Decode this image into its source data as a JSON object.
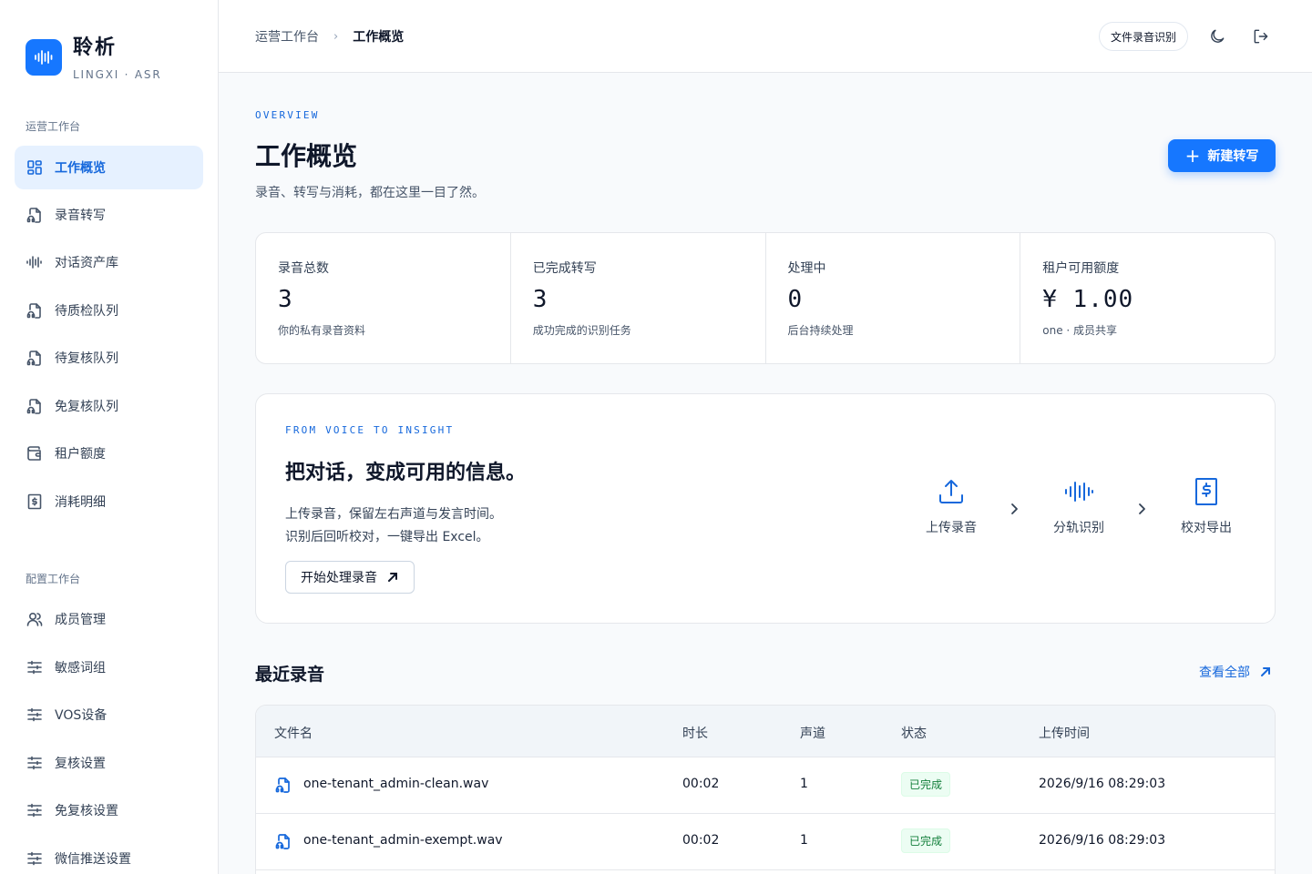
{
  "brand": {
    "name": "聆析",
    "sub": "LINGXI · ASR"
  },
  "sidebar": {
    "section1": "运营工作台",
    "section2": "配置工作台",
    "items": [
      {
        "label": "工作概览",
        "icon": "dashboard-icon"
      },
      {
        "label": "录音转写",
        "icon": "audio-file-icon"
      },
      {
        "label": "对话资产库",
        "icon": "waveform-icon"
      },
      {
        "label": "待质检队列",
        "icon": "audio-file-icon"
      },
      {
        "label": "待复核队列",
        "icon": "audio-file-icon"
      },
      {
        "label": "免复核队列",
        "icon": "audio-file-icon"
      },
      {
        "label": "租户额度",
        "icon": "wallet-icon"
      },
      {
        "label": "消耗明细",
        "icon": "dollar-receipt-icon"
      },
      {
        "label": "成员管理",
        "icon": "users-icon"
      },
      {
        "label": "敏感词组",
        "icon": "sliders-icon"
      },
      {
        "label": "VOS设备",
        "icon": "sliders-icon"
      },
      {
        "label": "复核设置",
        "icon": "sliders-icon"
      },
      {
        "label": "免复核设置",
        "icon": "sliders-icon"
      },
      {
        "label": "微信推送设置",
        "icon": "sliders-icon"
      }
    ]
  },
  "header": {
    "breadcrumb": [
      "运营工作台",
      "工作概览"
    ],
    "file_btn": "文件录音识别"
  },
  "overview": {
    "eyebrow": "OVERVIEW",
    "title": "工作概览",
    "subtitle": "录音、转写与消耗，都在这里一目了然。",
    "new_btn": "新建转写"
  },
  "stats": [
    {
      "label": "录音总数",
      "value": "3",
      "hint": "你的私有录音资料"
    },
    {
      "label": "已完成转写",
      "value": "3",
      "hint": "成功完成的识别任务"
    },
    {
      "label": "处理中",
      "value": "0",
      "hint": "后台持续处理"
    },
    {
      "label": "租户可用额度",
      "value": "¥ 1.00",
      "hint": "one · 成员共享"
    }
  ],
  "hero": {
    "eyebrow": "FROM VOICE TO INSIGHT",
    "title": "把对话，变成可用的信息。",
    "desc1": "上传录音，保留左右声道与发言时间。",
    "desc2": "识别后回听校对，一键导出 Excel。",
    "button": "开始处理录音",
    "steps": [
      "上传录音",
      "分轨识别",
      "校对导出"
    ]
  },
  "recent": {
    "title": "最近录音",
    "view_all": "查看全部",
    "columns": [
      "文件名",
      "时长",
      "声道",
      "状态",
      "上传时间"
    ],
    "rows": [
      {
        "name": "one-tenant_admin-clean.wav",
        "duration": "00:02",
        "channels": "1",
        "status": "已完成",
        "time": "2026/9/16 08:29:03"
      },
      {
        "name": "one-tenant_admin-exempt.wav",
        "duration": "00:02",
        "channels": "1",
        "status": "已完成",
        "time": "2026/9/16 08:29:03"
      }
    ]
  },
  "colors": {
    "accent": "#1677ff",
    "success": "#15803d"
  }
}
